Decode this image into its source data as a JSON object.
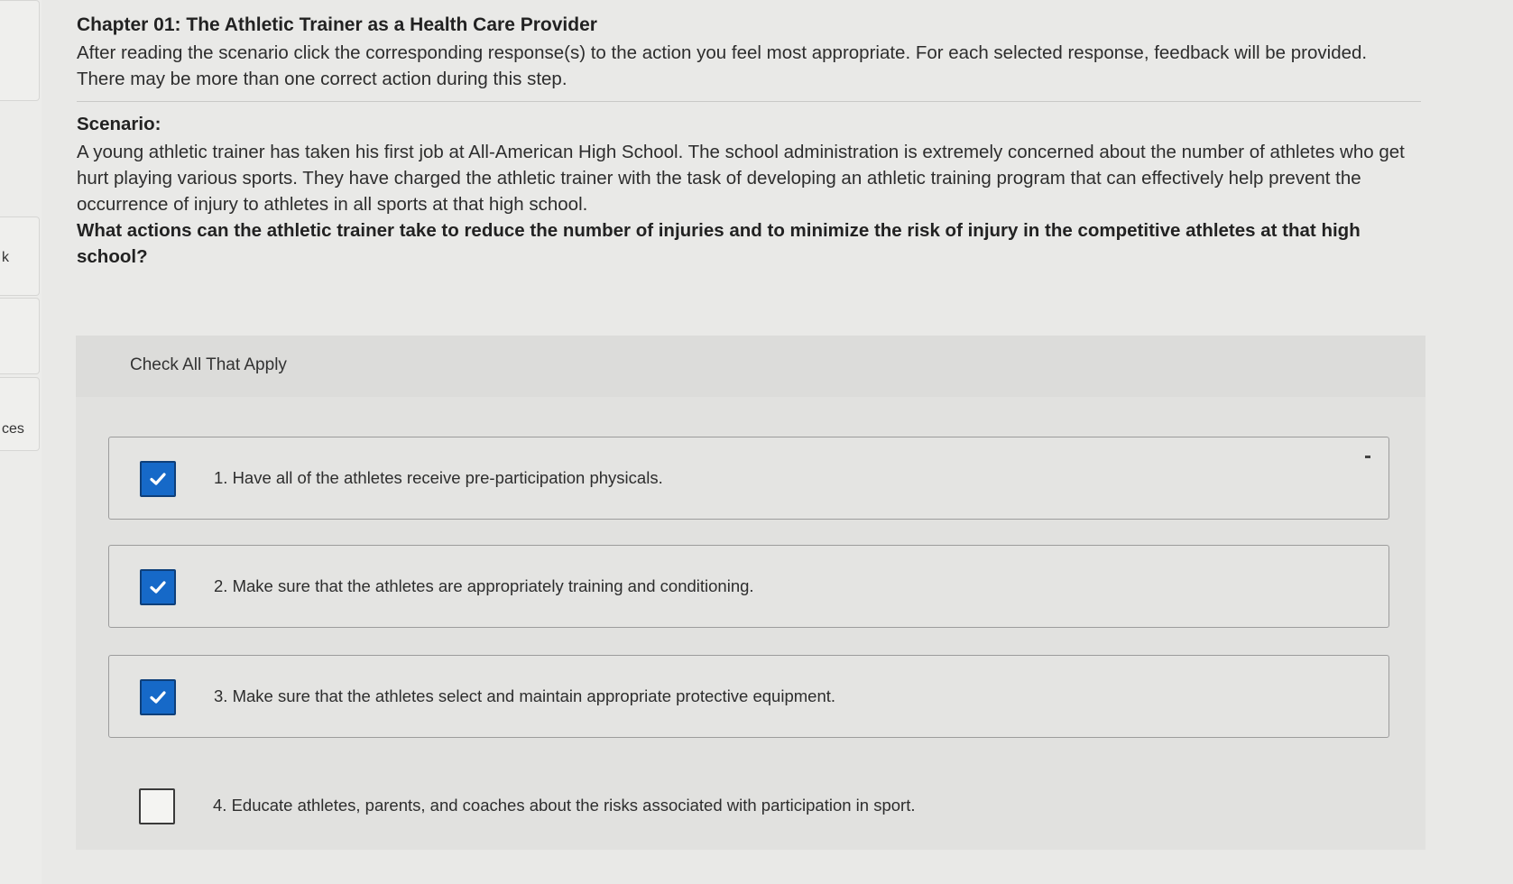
{
  "left_rail": {
    "tab_k": "k",
    "tab_ces": "ces"
  },
  "header": {
    "chapter_title": "Chapter 01: The Athletic Trainer as a Health Care Provider",
    "instructions": "After reading the scenario click the corresponding response(s) to the action you feel most appropriate. For each selected response, feedback will be provided. There may be more than one correct action during this step."
  },
  "scenario": {
    "heading": "Scenario:",
    "text": "A young athletic trainer has taken his first job at All-American High School. The school administration is extremely concerned about the number of athletes who get hurt playing various sports. They have charged the athletic trainer with the task of developing an athletic training program that can effectively help prevent the occurrence of injury to athletes in all sports at that high school.",
    "question": "What actions can the athletic trainer take to reduce the number of injuries and to minimize the risk of injury in the competitive athletes at that high school?"
  },
  "question_panel": {
    "title": "Check All That Apply",
    "options": [
      {
        "label": "1. Have all of the athletes receive pre-participation physicals.",
        "checked": true
      },
      {
        "label": "2. Make sure that the athletes are appropriately training and conditioning.",
        "checked": true
      },
      {
        "label": "3. Make sure that the athletes select and maintain appropriate protective equipment.",
        "checked": true
      },
      {
        "label": "4. Educate athletes, parents, and coaches about the risks associated with participation in sport.",
        "checked": false
      }
    ]
  },
  "colors": {
    "checkbox_checked": "#1669c8",
    "page_background": "#e9e9e7"
  }
}
